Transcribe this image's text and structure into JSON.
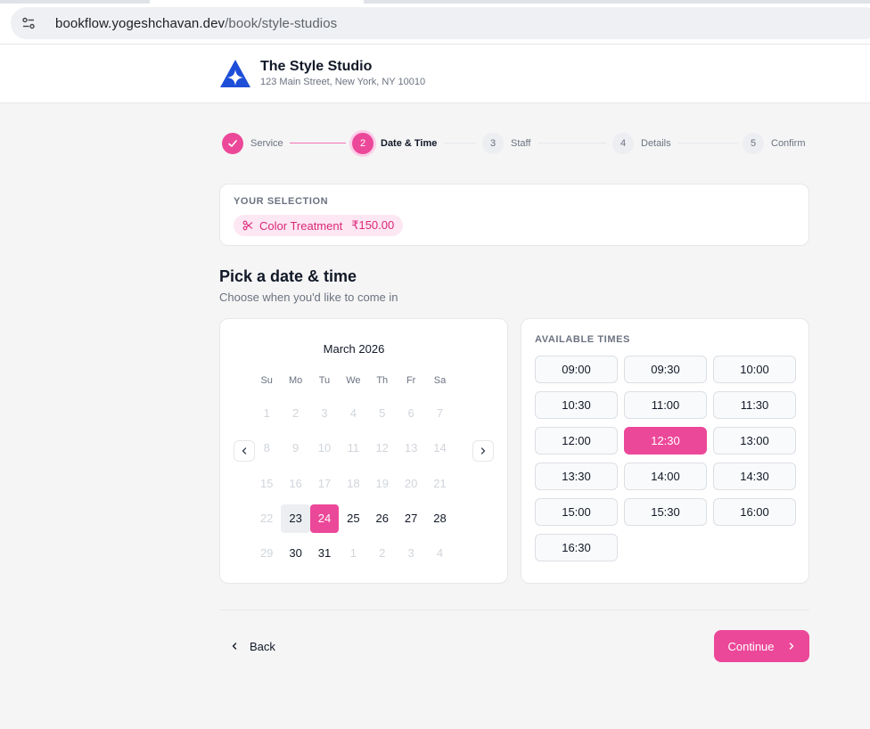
{
  "browser": {
    "url_host": "bookflow.yogeshchavan.dev",
    "url_path": "/book/style-studios"
  },
  "header": {
    "name": "The Style Studio",
    "address": "123 Main Street, New York, NY 10010",
    "brand_color": "#1d4ed8"
  },
  "stepper": {
    "steps": [
      {
        "number": "1",
        "label": "Service",
        "state": "done"
      },
      {
        "number": "2",
        "label": "Date & Time",
        "state": "current"
      },
      {
        "number": "3",
        "label": "Staff",
        "state": "pending"
      },
      {
        "number": "4",
        "label": "Details",
        "state": "pending"
      },
      {
        "number": "5",
        "label": "Confirm",
        "state": "pending"
      }
    ]
  },
  "selection": {
    "title": "YOUR SELECTION",
    "service": "Color Treatment",
    "price": "₹150.00",
    "icon": "scissors-icon"
  },
  "heading": {
    "title": "Pick a date & time",
    "subtitle": "Choose when you'd like to come in"
  },
  "calendar": {
    "month": "March 2026",
    "weekdays": [
      "Su",
      "Mo",
      "Tu",
      "We",
      "Th",
      "Fr",
      "Sa"
    ],
    "weeks": [
      [
        {
          "d": "1",
          "s": "muted"
        },
        {
          "d": "2",
          "s": "muted"
        },
        {
          "d": "3",
          "s": "muted"
        },
        {
          "d": "4",
          "s": "muted"
        },
        {
          "d": "5",
          "s": "muted"
        },
        {
          "d": "6",
          "s": "muted"
        },
        {
          "d": "7",
          "s": "muted"
        }
      ],
      [
        {
          "d": "8",
          "s": "muted"
        },
        {
          "d": "9",
          "s": "muted"
        },
        {
          "d": "10",
          "s": "muted"
        },
        {
          "d": "11",
          "s": "muted"
        },
        {
          "d": "12",
          "s": "muted"
        },
        {
          "d": "13",
          "s": "muted"
        },
        {
          "d": "14",
          "s": "muted"
        }
      ],
      [
        {
          "d": "15",
          "s": "muted"
        },
        {
          "d": "16",
          "s": "muted"
        },
        {
          "d": "17",
          "s": "muted"
        },
        {
          "d": "18",
          "s": "muted"
        },
        {
          "d": "19",
          "s": "muted"
        },
        {
          "d": "20",
          "s": "muted"
        },
        {
          "d": "21",
          "s": "muted"
        }
      ],
      [
        {
          "d": "22",
          "s": "muted"
        },
        {
          "d": "23",
          "s": "today"
        },
        {
          "d": "24",
          "s": "selected"
        },
        {
          "d": "25",
          "s": "normal"
        },
        {
          "d": "26",
          "s": "normal"
        },
        {
          "d": "27",
          "s": "normal"
        },
        {
          "d": "28",
          "s": "normal"
        }
      ],
      [
        {
          "d": "29",
          "s": "muted"
        },
        {
          "d": "30",
          "s": "normal"
        },
        {
          "d": "31",
          "s": "normal"
        },
        {
          "d": "1",
          "s": "muted"
        },
        {
          "d": "2",
          "s": "muted"
        },
        {
          "d": "3",
          "s": "muted"
        },
        {
          "d": "4",
          "s": "muted"
        }
      ]
    ],
    "selected_date": "24",
    "accent_color": "#ec4899"
  },
  "times": {
    "title": "AVAILABLE TIMES",
    "slots": [
      "09:00",
      "09:30",
      "10:00",
      "10:30",
      "11:00",
      "11:30",
      "12:00",
      "12:30",
      "13:00",
      "13:30",
      "14:00",
      "14:30",
      "15:00",
      "15:30",
      "16:00",
      "16:30"
    ],
    "selected": "12:30"
  },
  "footer": {
    "back_label": "Back",
    "continue_label": "Continue"
  }
}
